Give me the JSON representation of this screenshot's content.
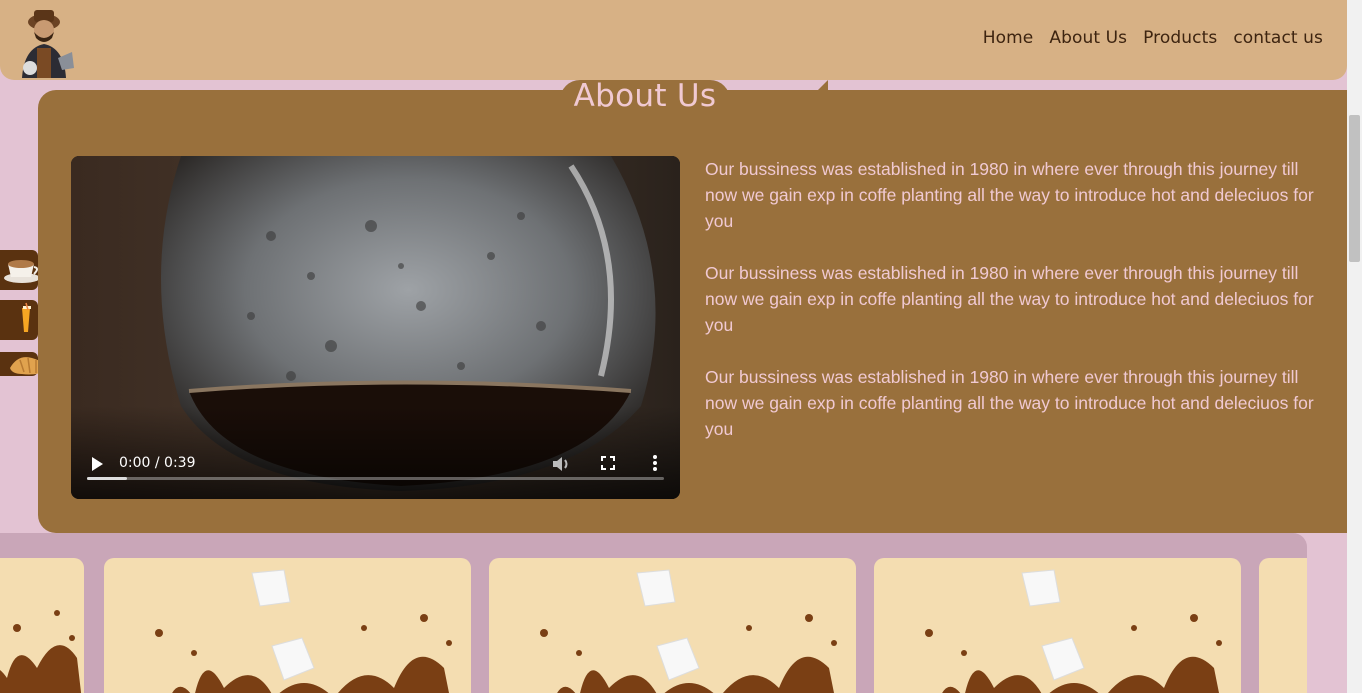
{
  "nav": {
    "items": [
      "Home",
      "About Us",
      "Products",
      "contact us"
    ]
  },
  "about": {
    "title": "About Us",
    "paragraphs": [
      "Our bussiness was established in 1980 in where ever through this journey till now we gain exp in coffe planting all the way to introduce hot and deleciuos for you",
      "Our bussiness was established in 1980 in where ever through this journey till now we gain exp in coffe planting all the way to introduce hot and deleciuos for you",
      "Our bussiness was established in 1980 in where ever through this journey till now we gain exp in coffe planting all the way to introduce hot and deleciuos for you"
    ]
  },
  "video": {
    "time": "0:00 / 0:39",
    "progress": 0.07
  },
  "side_icons": [
    "coffee-cup-icon",
    "juice-glass-icon",
    "croissant-icon"
  ],
  "colors": {
    "header": "#d7b185",
    "section": "#99703c",
    "background": "#e3c3d3",
    "accent_text": "#f0c9d2",
    "card": "#f4ddb1"
  }
}
